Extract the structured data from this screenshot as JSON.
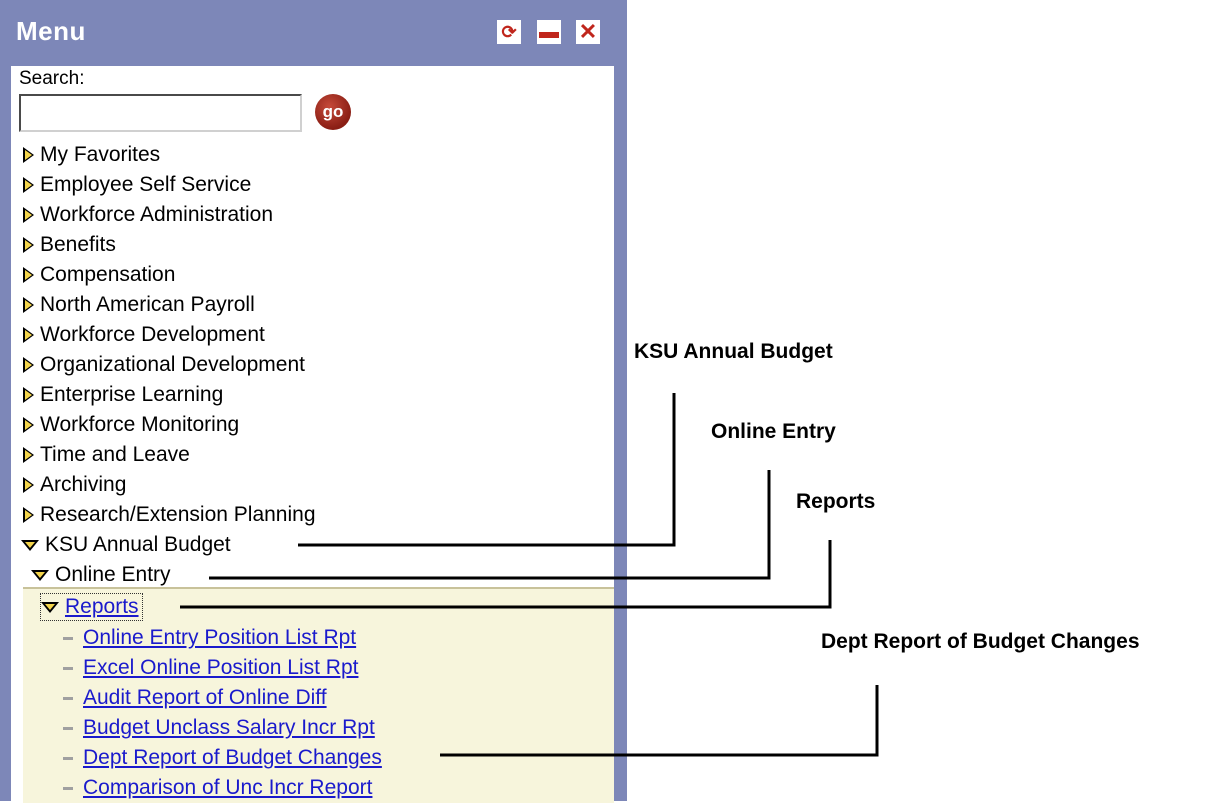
{
  "panel": {
    "title": "Menu",
    "refresh_icon": "refresh-icon",
    "minimize_icon": "minimize-icon",
    "close_icon": "close-icon"
  },
  "search": {
    "label": "Search:",
    "value": "",
    "placeholder": "",
    "go_label": "go"
  },
  "menu": {
    "collapsed_items": [
      "My Favorites",
      "Employee Self Service",
      "Workforce Administration",
      "Benefits",
      "Compensation",
      "North American Payroll",
      "Workforce Development",
      "Organizational Development",
      "Enterprise Learning",
      "Workforce Monitoring",
      "Time and Leave",
      "Archiving",
      "Research/Extension Planning"
    ],
    "expanded_item": "KSU Annual Budget",
    "sub_item": "Online Entry",
    "sub_sub_item": "Reports",
    "report_links": [
      "Online Entry Position List Rpt",
      "Excel Online Position List Rpt",
      "Audit Report of Online Diff",
      "Budget Unclass Salary Incr Rpt",
      "Dept Report of Budget Changes",
      "Comparison of Unc Incr Report"
    ]
  },
  "callouts": {
    "ksu_annual_budget": "KSU Annual Budget",
    "online_entry": "Online Entry",
    "reports": "Reports",
    "dept_report": "Dept Report of Budget Changes"
  },
  "colors": {
    "panel_frame": "#7d87b8",
    "link": "#1a1acc",
    "expanded_bg": "#f7f5dc"
  }
}
